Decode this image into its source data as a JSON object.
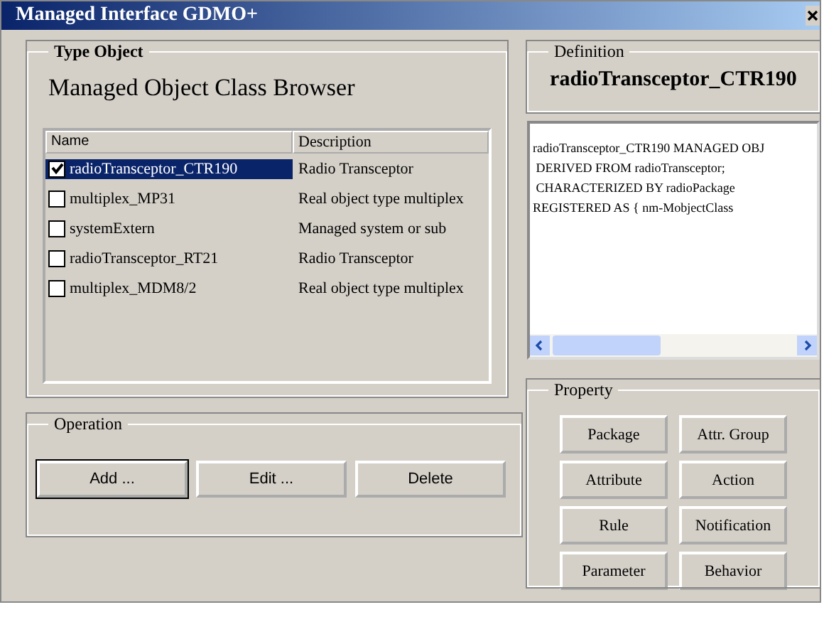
{
  "window": {
    "title": "Managed Interface GDMO+"
  },
  "type_object": {
    "legend": "Type Object",
    "heading": "Managed Object Class Browser",
    "columns": [
      "Name",
      "Description"
    ],
    "rows": [
      {
        "name": "radioTransceptor_CTR190",
        "description": "Radio Transceptor",
        "checked": true,
        "selected": true
      },
      {
        "name": "multiplex_MP31",
        "description": "Real object type multiplex",
        "checked": false,
        "selected": false
      },
      {
        "name": "systemExtern",
        "description": "Managed system or sub",
        "checked": false,
        "selected": false
      },
      {
        "name": "radioTransceptor_RT21",
        "description": "Radio Transceptor",
        "checked": false,
        "selected": false
      },
      {
        "name": "multiplex_MDM8/2",
        "description": "Real object type multiplex",
        "checked": false,
        "selected": false
      }
    ]
  },
  "operation": {
    "legend": "Operation",
    "buttons": [
      "Add ...",
      "Edit ...",
      "Delete"
    ]
  },
  "definition": {
    "legend": "Definition",
    "name": "radioTransceptor_CTR190",
    "lines": [
      "radioTransceptor_CTR190 MANAGED OBJ",
      " DERIVED FROM radioTransceptor;",
      " CHARACTERIZED BY radioPackage",
      "REGISTERED AS { nm-MobjectClass"
    ]
  },
  "property": {
    "legend": "Property",
    "buttons": [
      "Package",
      "Attr. Group",
      "Attribute",
      "Action",
      "Rule",
      "Notification",
      "Parameter",
      "Behavior"
    ]
  }
}
